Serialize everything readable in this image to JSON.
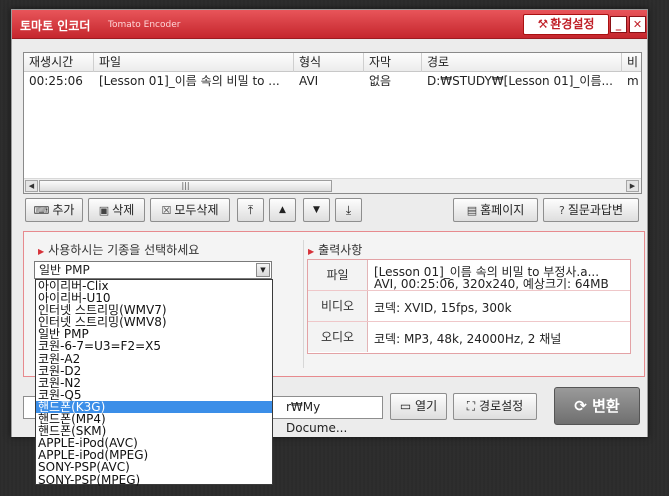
{
  "app": {
    "title": "토마토 인코더",
    "subtitle": "Tomato Encoder",
    "settings_label": "환경설정",
    "minimize": "_",
    "close": "✕"
  },
  "list": {
    "columns": [
      "재생시간",
      "파일",
      "형식",
      "자막",
      "경로",
      "비"
    ],
    "rows": [
      {
        "duration": "00:25:06",
        "file": "[Lesson 01]_이름 속의 비밀 to ...",
        "format": "AVI",
        "subtitle": "없음",
        "path": "D:₩STUDY₩[Lesson 01]_이름...",
        "extra": "m"
      }
    ],
    "scroll_thumb": "|||"
  },
  "toolbar": {
    "add": "추가",
    "delete": "삭제",
    "delete_all": "모두삭제",
    "move_top": "⤒",
    "move_up": "▲",
    "move_down": "▼",
    "move_bottom": "⤓",
    "homepage": "홈페이지",
    "faq": "질문과답변"
  },
  "device": {
    "label": "사용하시는 기종을 선택하세요",
    "selected": "일반 PMP",
    "options": [
      "아이리버-Clix",
      "아이리버-U10",
      "인터넷 스트리밍(WMV7)",
      "인터넷 스트리밍(WMV8)",
      "일반 PMP",
      "코원-6-7=U3=F2=X5",
      "코원-A2",
      "코원-D2",
      "코원-N2",
      "코원-Q5",
      "핸드폰(K3G)",
      "핸드폰(MP4)",
      "핸드폰(SKM)",
      "APPLE-iPod(AVC)",
      "APPLE-iPod(MPEG)",
      "SONY-PSP(AVC)",
      "SONY-PSP(MPEG)"
    ],
    "highlighted": "핸드폰(K3G)"
  },
  "output": {
    "label": "출력사항",
    "file_label": "파일",
    "file_line1": "[Lesson 01]_이름 속의 비밀 to 부정사.a...",
    "file_line2": "AVI, 00:25:06, 320x240, 예상크기: 64MB",
    "video_label": "비디오",
    "video_value": "코덱: XVID, 15fps, 300k",
    "audio_label": "오디오",
    "audio_value": "코덱: MP3, 48k, 24000Hz, 2 채널"
  },
  "bottom": {
    "path": "r₩My Docume...",
    "open": "열기",
    "path_settings": "경로설정",
    "convert": "변환"
  }
}
